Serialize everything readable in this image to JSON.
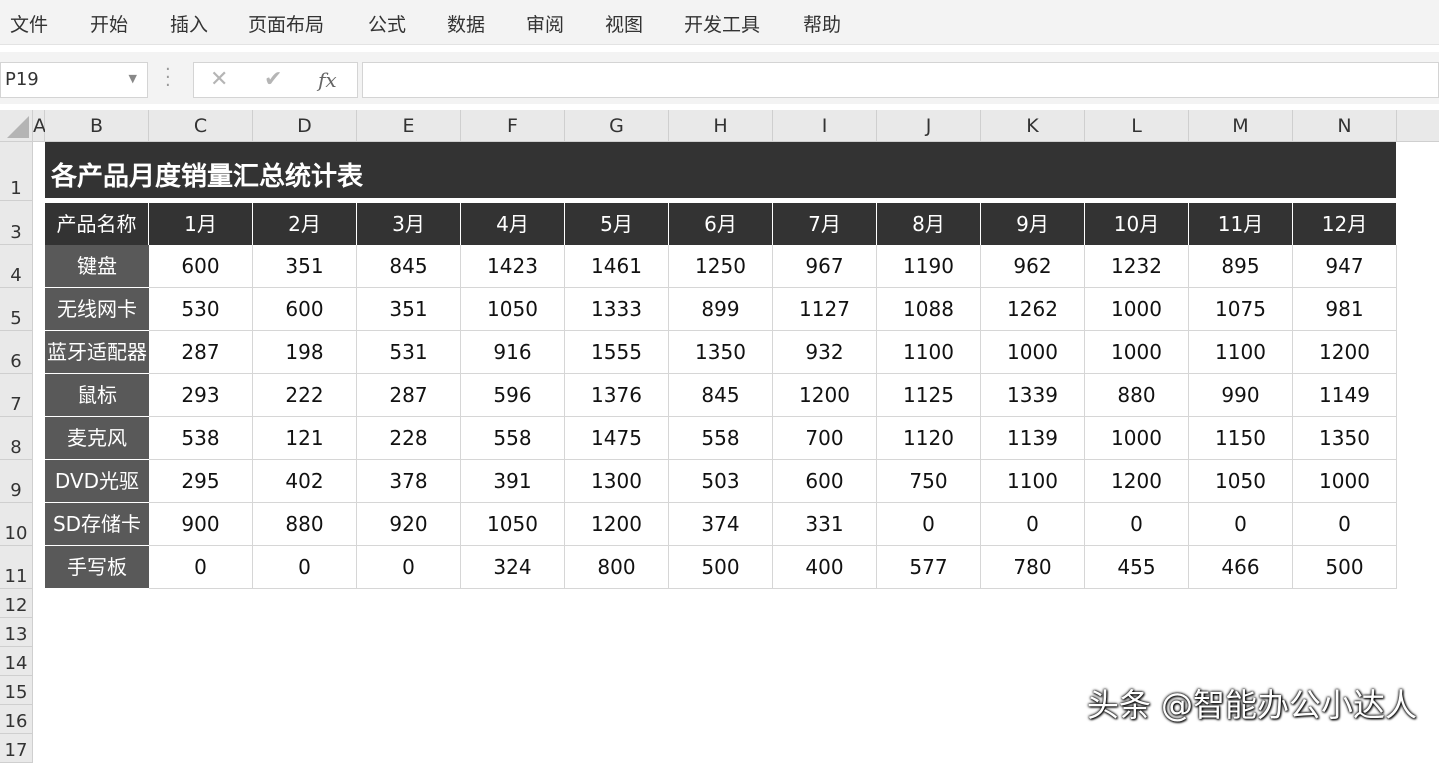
{
  "menu": [
    "文件",
    "开始",
    "插入",
    "页面布局",
    "公式",
    "数据",
    "审阅",
    "视图",
    "开发工具",
    "帮助"
  ],
  "formula_bar": {
    "name_box": "P19",
    "cancel_icon": "x-icon",
    "enter_icon": "check-icon",
    "fx_label": "fx",
    "formula": ""
  },
  "columns": [
    "A",
    "B",
    "C",
    "D",
    "E",
    "F",
    "G",
    "H",
    "I",
    "J",
    "K",
    "L",
    "M",
    "N"
  ],
  "rows": [
    "1",
    "3",
    "4",
    "5",
    "6",
    "7",
    "8",
    "9",
    "10",
    "11",
    "12",
    "13",
    "14",
    "15",
    "16",
    "17"
  ],
  "sheet": {
    "title": "各产品月度销量汇总统计表",
    "header": [
      "产品名称",
      "1月",
      "2月",
      "3月",
      "4月",
      "5月",
      "6月",
      "7月",
      "8月",
      "9月",
      "10月",
      "11月",
      "12月"
    ],
    "products": [
      {
        "name": "键盘",
        "values": [
          "600",
          "351",
          "845",
          "1423",
          "1461",
          "1250",
          "967",
          "1190",
          "962",
          "1232",
          "895",
          "947"
        ]
      },
      {
        "name": "无线网卡",
        "values": [
          "530",
          "600",
          "351",
          "1050",
          "1333",
          "899",
          "1127",
          "1088",
          "1262",
          "1000",
          "1075",
          "981"
        ]
      },
      {
        "name": "蓝牙适配器",
        "values": [
          "287",
          "198",
          "531",
          "916",
          "1555",
          "1350",
          "932",
          "1100",
          "1000",
          "1000",
          "1100",
          "1200"
        ]
      },
      {
        "name": "鼠标",
        "values": [
          "293",
          "222",
          "287",
          "596",
          "1376",
          "845",
          "1200",
          "1125",
          "1339",
          "880",
          "990",
          "1149"
        ]
      },
      {
        "name": "麦克风",
        "values": [
          "538",
          "121",
          "228",
          "558",
          "1475",
          "558",
          "700",
          "1120",
          "1139",
          "1000",
          "1150",
          "1350"
        ]
      },
      {
        "name": "DVD光驱",
        "values": [
          "295",
          "402",
          "378",
          "391",
          "1300",
          "503",
          "600",
          "750",
          "1100",
          "1200",
          "1050",
          "1000"
        ]
      },
      {
        "name": "SD存储卡",
        "values": [
          "900",
          "880",
          "920",
          "1050",
          "1200",
          "374",
          "331",
          "0",
          "0",
          "0",
          "0",
          "0"
        ]
      },
      {
        "name": "手写板",
        "values": [
          "0",
          "0",
          "0",
          "324",
          "800",
          "500",
          "400",
          "577",
          "780",
          "455",
          "466",
          "500"
        ]
      }
    ]
  },
  "watermark": "头条 @智能办公小达人"
}
